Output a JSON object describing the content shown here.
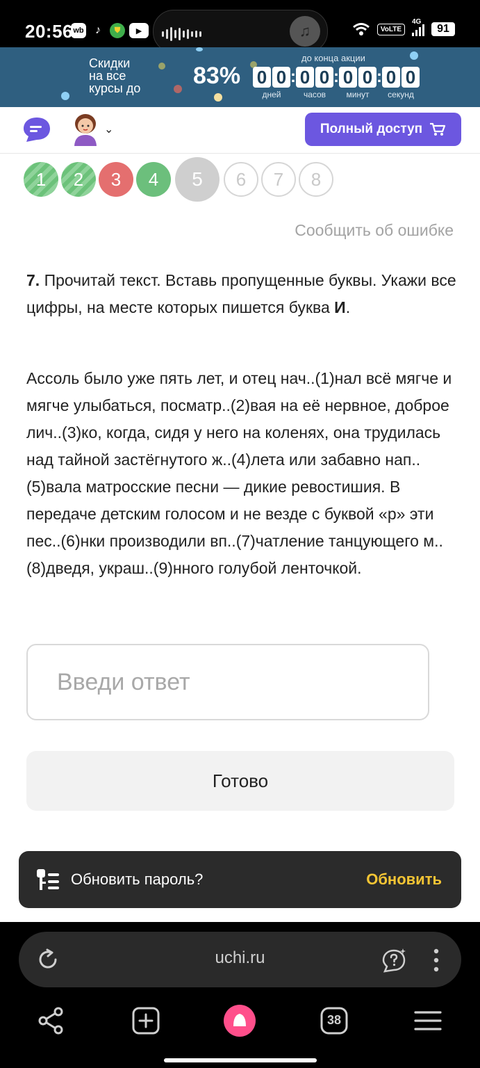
{
  "status_bar": {
    "time": "20:56",
    "apps": [
      "wb",
      "tiktok-icon",
      "vpn-icon",
      "youtube-icon"
    ],
    "network": "4G",
    "volte": "VoLTE",
    "battery": "91"
  },
  "promo": {
    "text_line1": "Скидки",
    "text_line2": "на все",
    "text_line3": "курсы до",
    "percent": "83%",
    "countdown_label": "до конца акции",
    "timer": [
      {
        "value": "00",
        "unit": "дней"
      },
      {
        "value": "00",
        "unit": "часов"
      },
      {
        "value": "00",
        "unit": "минут"
      },
      {
        "value": "00",
        "unit": "секунд"
      }
    ]
  },
  "header": {
    "full_access_label": "Полный доступ"
  },
  "progress": [
    {
      "n": "1",
      "state": "correct-partial"
    },
    {
      "n": "2",
      "state": "correct-partial"
    },
    {
      "n": "3",
      "state": "wrong"
    },
    {
      "n": "4",
      "state": "correct"
    },
    {
      "n": "5",
      "state": "current"
    },
    {
      "n": "6",
      "state": "future"
    },
    {
      "n": "7",
      "state": "future"
    },
    {
      "n": "8",
      "state": "future"
    }
  ],
  "report_error": "Сообщить об ошибке",
  "task": {
    "number": "7.",
    "instruction": " Прочитай текст. Вставь пропущенные буквы. Укажи все цифры, на месте которых пишется буква ",
    "letter": "И",
    "end": ".",
    "text": "Ассоль было уже пять лет, и отец нач..(1)нал всё мягче и мягче улыбаться, посматр..(2)вая на её нервное, доброе лич..(3)ко, когда, сидя у него на коленях, она трудилась над тайной застёгнутого ж..(4)лета или забавно нап..(5)вала матросские песни — дикие ревостишия. В передаче детским голосом и не везде с буквой «р» эти пес..(6)нки производили вп..(7)чатление танцующего м..(8)дведя, украш..(9)нного голубой ленточкой."
  },
  "answer": {
    "placeholder": "Введи ответ",
    "value": ""
  },
  "done_label": "Готово",
  "toast": {
    "text": "Обновить пароль?",
    "action": "Обновить"
  },
  "browser": {
    "url": "uchi.ru",
    "tabs_count": "38"
  },
  "colors": {
    "promo_bg": "#2f5f80",
    "accent": "#6c57e0",
    "correct": "#6cbf7c",
    "wrong": "#e46f6f",
    "toast_action": "#f4c534"
  }
}
